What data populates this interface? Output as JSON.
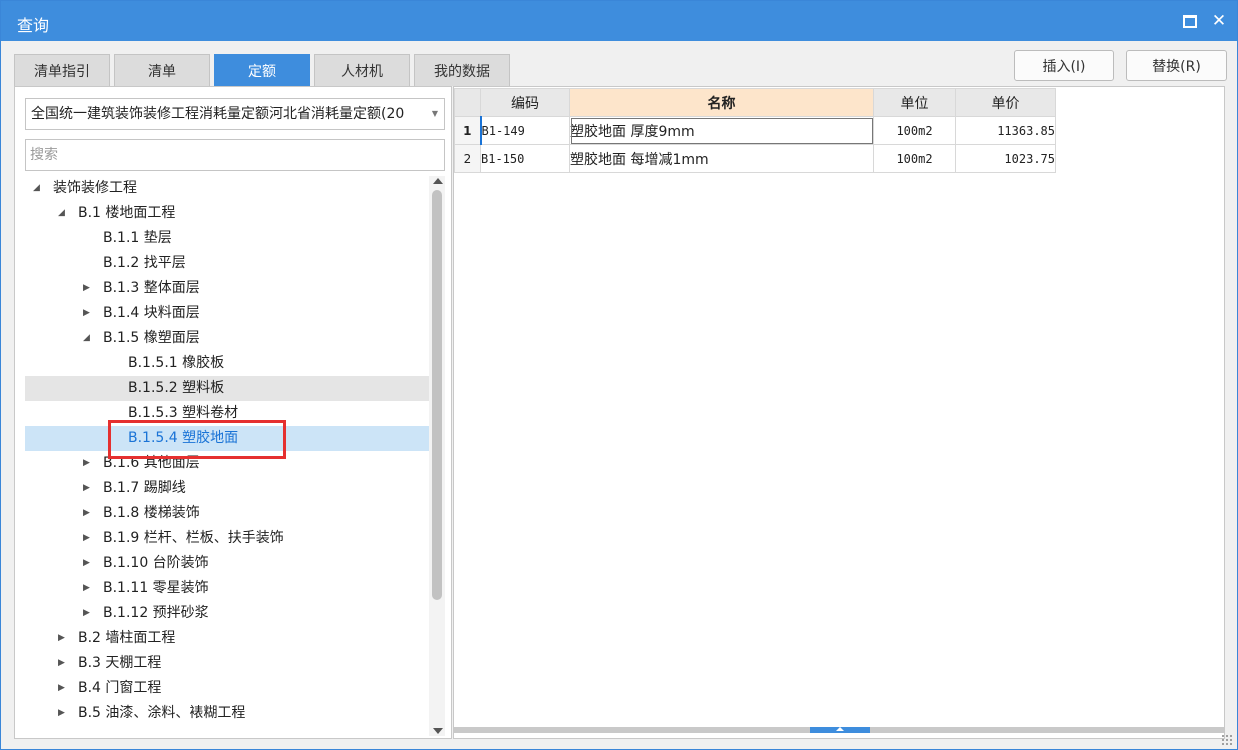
{
  "window": {
    "title": "查询"
  },
  "tabs": [
    {
      "label": "清单指引",
      "active": false
    },
    {
      "label": "清单",
      "active": false
    },
    {
      "label": "定额",
      "active": true
    },
    {
      "label": "人材机",
      "active": false
    },
    {
      "label": "我的数据",
      "active": false
    }
  ],
  "actions": {
    "insert_label": "插入(I)",
    "replace_label": "替换(R)"
  },
  "library": {
    "selected": "全国统一建筑装饰装修工程消耗量定额河北省消耗量定额(20"
  },
  "search": {
    "placeholder": "搜索"
  },
  "tree": {
    "nodes": [
      {
        "label": "装饰装修工程",
        "expander": "expanded"
      },
      {
        "label": "B.1 楼地面工程",
        "expander": "expanded"
      },
      {
        "label": "B.1.1 垫层",
        "expander": "none"
      },
      {
        "label": "B.1.2 找平层",
        "expander": "none"
      },
      {
        "label": "B.1.3 整体面层",
        "expander": "collapsed"
      },
      {
        "label": "B.1.4 块料面层",
        "expander": "collapsed"
      },
      {
        "label": "B.1.5 橡塑面层",
        "expander": "expanded"
      },
      {
        "label": "B.1.5.1 橡胶板",
        "expander": "none"
      },
      {
        "label": "B.1.5.2 塑料板",
        "expander": "none"
      },
      {
        "label": "B.1.5.3 塑料卷材",
        "expander": "none"
      },
      {
        "label": "B.1.5.4 塑胶地面",
        "expander": "none"
      },
      {
        "label": "B.1.6 其他面层",
        "expander": "collapsed"
      },
      {
        "label": "B.1.7 踢脚线",
        "expander": "collapsed"
      },
      {
        "label": "B.1.8 楼梯装饰",
        "expander": "collapsed"
      },
      {
        "label": "B.1.9 栏杆、栏板、扶手装饰",
        "expander": "collapsed"
      },
      {
        "label": "B.1.10 台阶装饰",
        "expander": "collapsed"
      },
      {
        "label": "B.1.11 零星装饰",
        "expander": "collapsed"
      },
      {
        "label": "B.1.12 预拌砂浆",
        "expander": "collapsed"
      },
      {
        "label": "B.2 墙柱面工程",
        "expander": "collapsed"
      },
      {
        "label": "B.3 天棚工程",
        "expander": "collapsed"
      },
      {
        "label": "B.4 门窗工程",
        "expander": "collapsed"
      },
      {
        "label": "B.5 油漆、涂料、裱糊工程",
        "expander": "collapsed"
      }
    ]
  },
  "table": {
    "headers": [
      "编码",
      "名称",
      "单位",
      "单价"
    ],
    "rows": [
      {
        "num": "1",
        "code": "B1-149",
        "name": "塑胶地面 厚度9mm",
        "unit": "100m2",
        "price": "11363.85"
      },
      {
        "num": "2",
        "code": "B1-150",
        "name": "塑胶地面 每增减1mm",
        "unit": "100m2",
        "price": "1023.75"
      }
    ]
  },
  "colors": {
    "accent": "#3e8ddd",
    "selected_row_bg": "#cce4f7",
    "highlight_border": "#e53030",
    "name_header_bg": "#fde5cb"
  },
  "icons": {
    "maximize": "maximize-icon",
    "close": "close-icon",
    "dropdown": "chevron-down-icon"
  }
}
